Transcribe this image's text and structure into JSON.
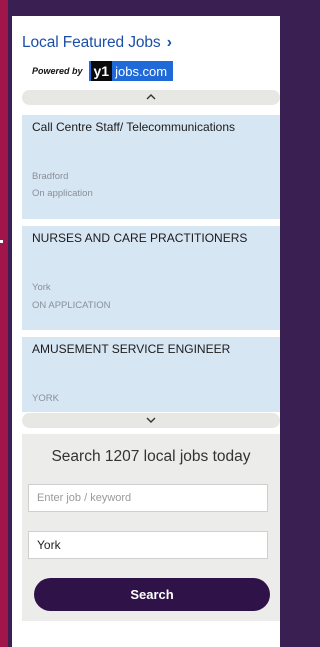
{
  "widget": {
    "title": "Local Featured Jobs",
    "title_chevron": "›",
    "powered_by": "Powered by",
    "logo_mark": "y1",
    "logo_text": "jobs.com"
  },
  "nav": {
    "up_icon": "^",
    "down_icon": "⌄"
  },
  "jobs": [
    {
      "title": "Call Centre Staff/ Telecommunications",
      "location": "Bradford",
      "salary": "On application"
    },
    {
      "title": "NURSES AND CARE PRACTITIONERS",
      "location": "York",
      "salary": "ON APPLICATION"
    },
    {
      "title": "AMUSEMENT SERVICE ENGINEER",
      "location": "YORK",
      "salary": ""
    }
  ],
  "search": {
    "heading": "Search 1207 local jobs today",
    "keyword_placeholder": "Enter job / keyword",
    "keyword_value": "",
    "location_value": "York",
    "button_label": "Search"
  },
  "colors": {
    "page_bg": "#3a1f52",
    "accent_strip": "#a0154a",
    "title_link": "#1c4fa8",
    "job_card_bg": "#d7e6f3",
    "search_button": "#2e1248"
  }
}
